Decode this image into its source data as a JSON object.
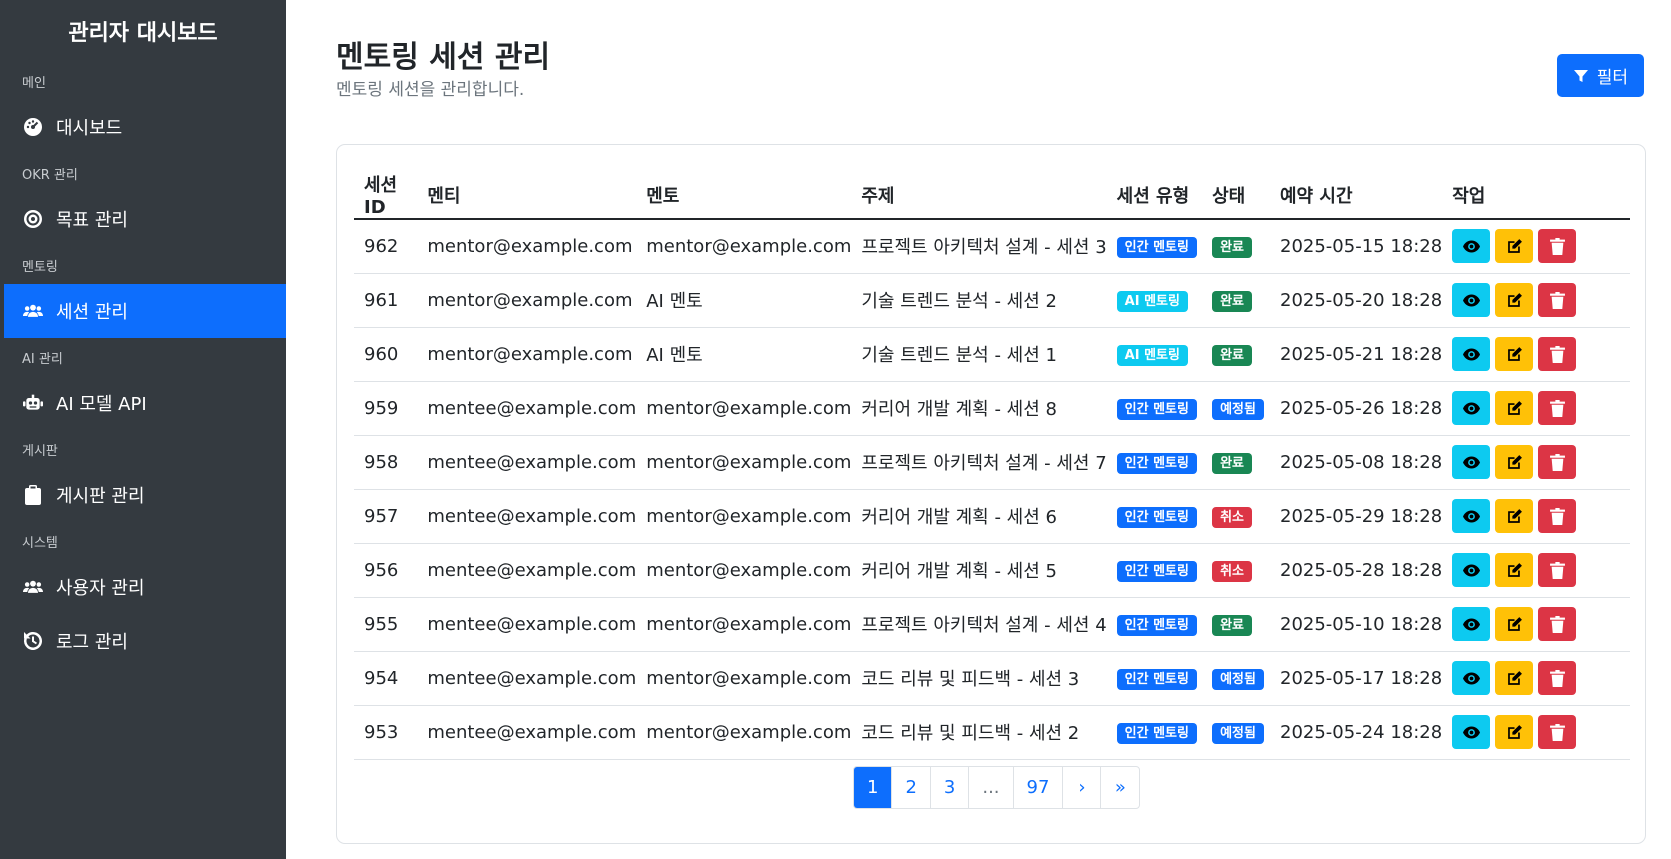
{
  "sidebar": {
    "brand": "관리자 대시보드",
    "sections": [
      {
        "label": "메인",
        "items": [
          {
            "label": "대시보드",
            "icon": "gauge-icon"
          }
        ]
      },
      {
        "label": "OKR 관리",
        "items": [
          {
            "label": "목표 관리",
            "icon": "target-icon"
          }
        ]
      },
      {
        "label": "멘토링",
        "items": [
          {
            "label": "세션 관리",
            "icon": "users-icon",
            "active": true
          }
        ]
      },
      {
        "label": "AI 관리",
        "items": [
          {
            "label": "AI 모델 API",
            "icon": "robot-icon"
          }
        ]
      },
      {
        "label": "게시판",
        "items": [
          {
            "label": "게시판 관리",
            "icon": "clipboard-icon"
          }
        ]
      },
      {
        "label": "시스템",
        "items": [
          {
            "label": "사용자 관리",
            "icon": "users-icon"
          },
          {
            "label": "로그 관리",
            "icon": "history-icon"
          }
        ]
      }
    ]
  },
  "header": {
    "title": "멘토링 세션 관리",
    "subtitle": "멘토링 세션을 관리합니다.",
    "filter_label": "필터"
  },
  "table": {
    "columns": [
      "세션 ID",
      "멘티",
      "멘토",
      "주제",
      "세션 유형",
      "상태",
      "예약 시간",
      "작업"
    ],
    "rows": [
      {
        "id": "962",
        "mentee": "mentor@example.com",
        "mentor": "mentor@example.com",
        "topic": "프로젝트 아키텍처 설계 - 세션 3",
        "type": "인간 멘토링",
        "type_color": "primary",
        "status": "완료",
        "status_color": "success",
        "time": "2025-05-15 18:28"
      },
      {
        "id": "961",
        "mentee": "mentor@example.com",
        "mentor": "AI 멘토",
        "topic": "기술 트렌드 분석 - 세션 2",
        "type": "AI 멘토링",
        "type_color": "info",
        "status": "완료",
        "status_color": "success",
        "time": "2025-05-20 18:28"
      },
      {
        "id": "960",
        "mentee": "mentor@example.com",
        "mentor": "AI 멘토",
        "topic": "기술 트렌드 분석 - 세션 1",
        "type": "AI 멘토링",
        "type_color": "info",
        "status": "완료",
        "status_color": "success",
        "time": "2025-05-21 18:28"
      },
      {
        "id": "959",
        "mentee": "mentee@example.com",
        "mentor": "mentor@example.com",
        "topic": "커리어 개발 계획 - 세션 8",
        "type": "인간 멘토링",
        "type_color": "primary",
        "status": "예정됨",
        "status_color": "primary",
        "time": "2025-05-26 18:28"
      },
      {
        "id": "958",
        "mentee": "mentee@example.com",
        "mentor": "mentor@example.com",
        "topic": "프로젝트 아키텍처 설계 - 세션 7",
        "type": "인간 멘토링",
        "type_color": "primary",
        "status": "완료",
        "status_color": "success",
        "time": "2025-05-08 18:28"
      },
      {
        "id": "957",
        "mentee": "mentee@example.com",
        "mentor": "mentor@example.com",
        "topic": "커리어 개발 계획 - 세션 6",
        "type": "인간 멘토링",
        "type_color": "primary",
        "status": "취소",
        "status_color": "danger",
        "time": "2025-05-29 18:28"
      },
      {
        "id": "956",
        "mentee": "mentee@example.com",
        "mentor": "mentor@example.com",
        "topic": "커리어 개발 계획 - 세션 5",
        "type": "인간 멘토링",
        "type_color": "primary",
        "status": "취소",
        "status_color": "danger",
        "time": "2025-05-28 18:28"
      },
      {
        "id": "955",
        "mentee": "mentee@example.com",
        "mentor": "mentor@example.com",
        "topic": "프로젝트 아키텍처 설계 - 세션 4",
        "type": "인간 멘토링",
        "type_color": "primary",
        "status": "완료",
        "status_color": "success",
        "time": "2025-05-10 18:28"
      },
      {
        "id": "954",
        "mentee": "mentee@example.com",
        "mentor": "mentor@example.com",
        "topic": "코드 리뷰 및 피드백 - 세션 3",
        "type": "인간 멘토링",
        "type_color": "primary",
        "status": "예정됨",
        "status_color": "primary",
        "time": "2025-05-17 18:28"
      },
      {
        "id": "953",
        "mentee": "mentee@example.com",
        "mentor": "mentor@example.com",
        "topic": "코드 리뷰 및 피드백 - 세션 2",
        "type": "인간 멘토링",
        "type_color": "primary",
        "status": "예정됨",
        "status_color": "primary",
        "time": "2025-05-24 18:28"
      }
    ]
  },
  "pagination": {
    "pages": [
      {
        "label": "1",
        "active": true
      },
      {
        "label": "2"
      },
      {
        "label": "3"
      },
      {
        "label": "...",
        "disabled": true
      },
      {
        "label": "97"
      },
      {
        "label": "›"
      },
      {
        "label": "»"
      }
    ]
  },
  "colors": {
    "sidebar_bg": "#343a40",
    "primary": "#0d6efd",
    "info": "#0dcaf0",
    "success": "#198754",
    "danger": "#dc3545",
    "warning": "#ffc107"
  }
}
